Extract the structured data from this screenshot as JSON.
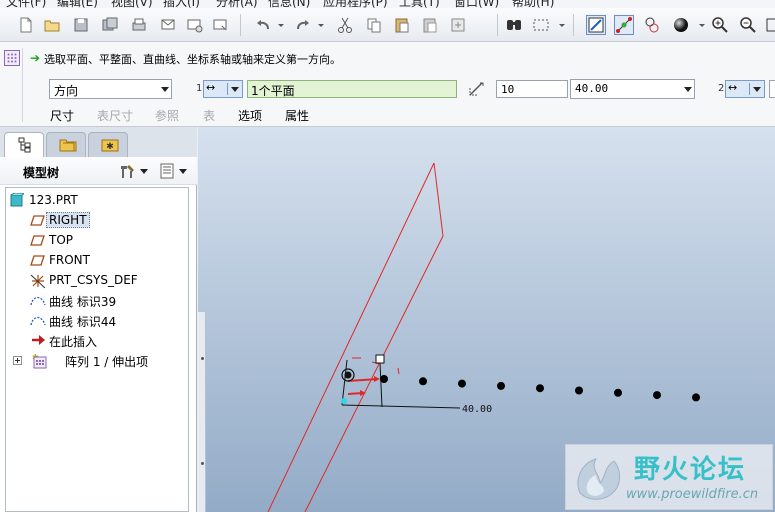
{
  "menu": [
    "文件(F)",
    "编辑(E)",
    "视图(V)",
    "插入(I)",
    "分析(A)",
    "信息(N)",
    "应用程序(P)",
    "工具(T)",
    "窗口(W)",
    "帮助(H)"
  ],
  "toolbar": {
    "icons": [
      "new-file-icon",
      "open-icon",
      "save-icon",
      "save-copy-icon",
      "print-icon",
      "email-icon",
      "email-link-icon",
      "undo-icon",
      "redo-icon",
      "cut-icon",
      "copy-icon",
      "paste-icon",
      "paste-special-icon",
      "find-icon",
      "select-box-icon",
      "repaint-icon",
      "spin-center-icon",
      "orient-icon",
      "shading-icon",
      "zoom-in-icon",
      "zoom-out-icon",
      "refit-icon"
    ]
  },
  "dashboard": {
    "prompt": "选取平面、平整面、直曲线、坐标系轴或轴来定义第一方向。",
    "type_select": "方向",
    "ref1_index": "1",
    "ref1_value": "1个平面",
    "count_value": "10",
    "spacing_value": "40.00",
    "ref2_index": "2",
    "tabs": [
      {
        "label": "尺寸",
        "enabled": true
      },
      {
        "label": "表尺寸",
        "enabled": false
      },
      {
        "label": "参照",
        "enabled": false
      },
      {
        "label": "表",
        "enabled": false
      },
      {
        "label": "选项",
        "enabled": true
      },
      {
        "label": "属性",
        "enabled": true
      }
    ]
  },
  "model_tree": {
    "title": "模型树",
    "items": [
      {
        "label": "123.PRT",
        "icon": "part-icon",
        "selected": false
      },
      {
        "label": "RIGHT",
        "icon": "datum-plane-icon",
        "selected": true
      },
      {
        "label": "TOP",
        "icon": "datum-plane-icon",
        "selected": false
      },
      {
        "label": "FRONT",
        "icon": "datum-plane-icon",
        "selected": false
      },
      {
        "label": "PRT_CSYS_DEF",
        "icon": "csys-icon",
        "selected": false
      },
      {
        "label": "曲线 标识39",
        "icon": "curve-icon",
        "selected": false
      },
      {
        "label": "曲线 标识44",
        "icon": "curve-icon",
        "selected": false
      },
      {
        "label": "在此插入",
        "icon": "insert-here-icon",
        "selected": false
      },
      {
        "label": "阵列 1 / 伸出项",
        "icon": "pattern-icon",
        "selected": false
      }
    ]
  },
  "viewport": {
    "dimension_label": "40.00",
    "pattern_points": 10
  },
  "watermark": {
    "title": "野火论坛",
    "url": "www.proewildfire.cn"
  }
}
